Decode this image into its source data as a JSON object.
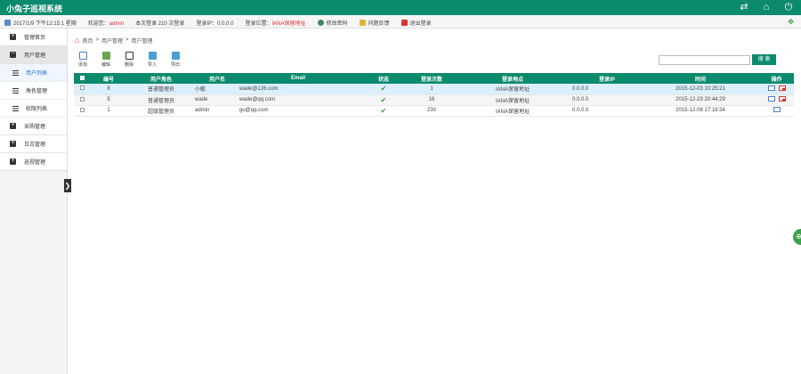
{
  "header": {
    "title": "小兔子巡视系统",
    "icons": [
      "refresh-icon",
      "home-icon",
      "power-icon"
    ]
  },
  "infobar": {
    "datetime": "2017/1/9 下午12:15:1 星期",
    "welcome": "欢迎您：",
    "username": "admin",
    "visit_text": "本次登录 210 次登录",
    "login_ip": "登录IP：0.0.0.0",
    "login_location_label": "登录位置：",
    "login_location": "IANA保留地址",
    "profile": "修改密码",
    "help": "问题反馈",
    "logout": "退出登录"
  },
  "sidebar": {
    "items": [
      {
        "label": "管理首页",
        "open": false
      },
      {
        "label": "用户管理",
        "open": true
      },
      {
        "label": "采购管理",
        "open": false
      },
      {
        "label": "日志管理",
        "open": false
      },
      {
        "label": "巡视管理",
        "open": false
      }
    ],
    "submenu": [
      {
        "label": "用户列表",
        "active": true
      },
      {
        "label": "角色管理",
        "active": false
      },
      {
        "label": "权限列表",
        "active": false
      }
    ],
    "collapse_glyph": "❯"
  },
  "breadcrumb": {
    "home": "首页",
    "sep1": ">",
    "level1": "用户管理",
    "sep2": ">",
    "level2": "用户管理"
  },
  "toolbar": {
    "add": "添加",
    "edit": "编辑",
    "delete": "删除",
    "import": "导入",
    "export": "导出"
  },
  "search": {
    "value": "",
    "placeholder": "",
    "button": "搜 索"
  },
  "table": {
    "columns": [
      "编号",
      "用户角色",
      "用户名",
      "Email",
      "状态",
      "登录次数",
      "登录地点",
      "登录IP",
      "时间",
      "操作"
    ],
    "rows": [
      {
        "id": "8",
        "role": "普通管理员",
        "username": "小敏",
        "email": "wade@126.com",
        "status": "✔",
        "count": "1",
        "location": "IANA保留地址",
        "ip": "0.0.0.0",
        "time": "2015-12-03 10:25:21",
        "can_delete": true
      },
      {
        "id": "5",
        "role": "普通管理员",
        "username": "wade",
        "email": "wade@qq.com",
        "status": "✔",
        "count": "16",
        "location": "IANA保留地址",
        "ip": "0.0.0.0",
        "time": "2015-12-29 20:44:29",
        "can_delete": true
      },
      {
        "id": "1",
        "role": "超级管理员",
        "username": "admin",
        "email": "gu@qq.com",
        "status": "✔",
        "count": "230",
        "location": "IANA保留地址",
        "ip": "0.0.0.0",
        "time": "2015-12-08 17:18:34",
        "can_delete": false
      }
    ]
  },
  "colors": {
    "primary": "#0c8a6e",
    "highlight_row": "#ddeffd",
    "danger": "#dd3333"
  }
}
